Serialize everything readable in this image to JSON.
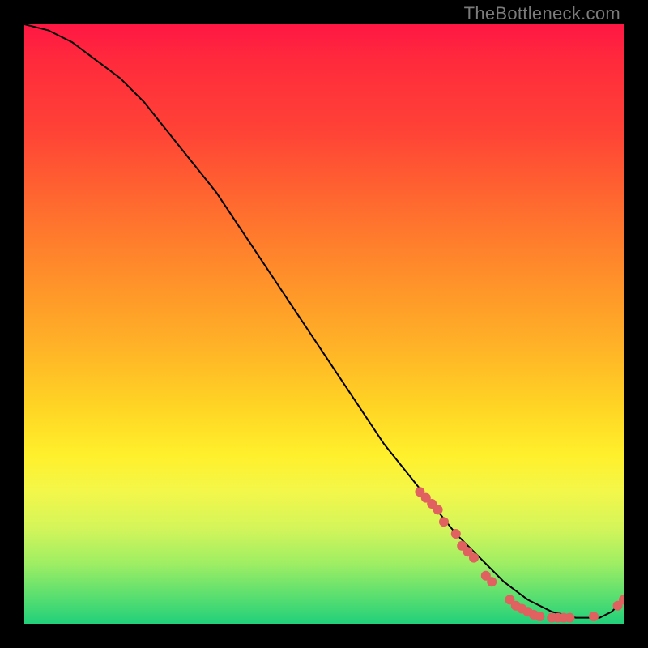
{
  "watermark": "TheBottleneck.com",
  "chart_data": {
    "type": "line",
    "title": "",
    "xlabel": "",
    "ylabel": "",
    "xlim": [
      0,
      100
    ],
    "ylim": [
      0,
      100
    ],
    "series": [
      {
        "name": "curve",
        "x": [
          0,
          4,
          8,
          12,
          16,
          20,
          24,
          28,
          32,
          36,
          40,
          44,
          48,
          52,
          56,
          60,
          64,
          68,
          72,
          76,
          80,
          84,
          88,
          92,
          96,
          98,
          100
        ],
        "y": [
          100,
          99,
          97,
          94,
          91,
          87,
          82,
          77,
          72,
          66,
          60,
          54,
          48,
          42,
          36,
          30,
          25,
          20,
          15,
          11,
          7,
          4,
          2,
          1,
          1,
          2,
          4
        ]
      }
    ],
    "markers": [
      {
        "x": 66,
        "y": 22
      },
      {
        "x": 67,
        "y": 21
      },
      {
        "x": 68,
        "y": 20
      },
      {
        "x": 69,
        "y": 19
      },
      {
        "x": 70,
        "y": 17
      },
      {
        "x": 72,
        "y": 15
      },
      {
        "x": 73,
        "y": 13
      },
      {
        "x": 74,
        "y": 12
      },
      {
        "x": 75,
        "y": 11
      },
      {
        "x": 77,
        "y": 8
      },
      {
        "x": 78,
        "y": 7
      },
      {
        "x": 81,
        "y": 4
      },
      {
        "x": 82,
        "y": 3
      },
      {
        "x": 83,
        "y": 2.5
      },
      {
        "x": 84,
        "y": 2
      },
      {
        "x": 85,
        "y": 1.5
      },
      {
        "x": 86,
        "y": 1.2
      },
      {
        "x": 88,
        "y": 1
      },
      {
        "x": 89,
        "y": 1
      },
      {
        "x": 90,
        "y": 1
      },
      {
        "x": 91,
        "y": 1
      },
      {
        "x": 95,
        "y": 1.2
      },
      {
        "x": 99,
        "y": 3
      },
      {
        "x": 100,
        "y": 4
      }
    ],
    "marker_color": "#e16060",
    "curve_color": "#000000"
  }
}
